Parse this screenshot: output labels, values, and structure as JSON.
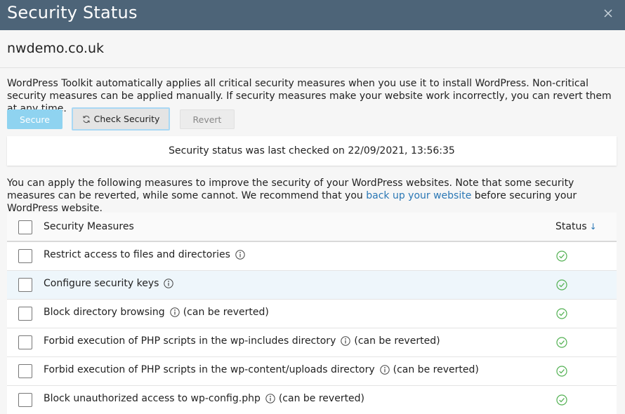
{
  "window": {
    "title": "Security Status",
    "close_icon": "close-icon"
  },
  "domain": "nwdemo.co.uk",
  "intro": "WordPress Toolkit automatically applies all critical security measures when you use it to install WordPress. Non-critical security measures can be applied manually. If security measures make your website work incorrectly, you can revert them at any time.",
  "buttons": {
    "secure": "Secure",
    "check_security": "Check Security",
    "revert": "Revert"
  },
  "status_message": "Security status was last checked on 22/09/2021, 13:56:35",
  "note": {
    "before": "You can apply the following measures to improve the security of your WordPress websites. Note that some security measures can be reverted, while some cannot. We recommend that you ",
    "link": "back up your website",
    "after": " before securing your WordPress website."
  },
  "table": {
    "headers": {
      "measures": "Security Measures",
      "status": "Status",
      "sort_icon": "↓"
    },
    "rows": [
      {
        "label": "Restrict access to files and directories",
        "suffix": "",
        "status": "ok"
      },
      {
        "label": "Configure security keys",
        "suffix": "",
        "status": "ok"
      },
      {
        "label": "Block directory browsing",
        "suffix": "(can be reverted)",
        "status": "ok"
      },
      {
        "label": "Forbid execution of PHP scripts in the wp-includes directory",
        "suffix": "(can be reverted)",
        "status": "ok"
      },
      {
        "label": "Forbid execution of PHP scripts in the wp-content/uploads directory",
        "suffix": "(can be reverted)",
        "status": "ok"
      },
      {
        "label": "Block unauthorized access to wp-config.php",
        "suffix": "(can be reverted)",
        "status": "ok"
      }
    ]
  },
  "colors": {
    "titlebar": "#4d6478",
    "accent": "#2a77b5",
    "success": "#53b153",
    "secure_button": "#8fd3f0"
  }
}
